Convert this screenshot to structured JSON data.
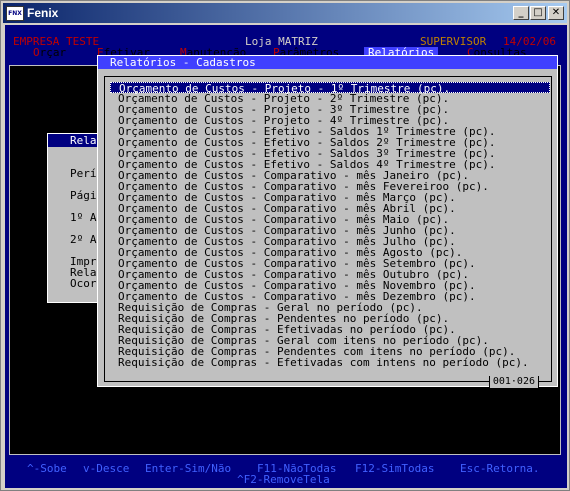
{
  "window": {
    "title": "Fenix",
    "icon_text": "FNX",
    "minimize": "_",
    "maximize": "□",
    "close": "✕"
  },
  "header": {
    "company": "EMPRESA TESTE",
    "store": "Loja MATRIZ",
    "user": "SUPERVISOR",
    "date": "14/02/06",
    "colors": {
      "company": "#c00000",
      "store": "#d4d0c8",
      "user": "#c08000",
      "date": "#c00000"
    }
  },
  "menu": [
    {
      "hot": "O",
      "rest": "rçar"
    },
    {
      "hot": "E",
      "rest": "fetivar"
    },
    {
      "hot": "M",
      "rest": "anutenção"
    },
    {
      "hot": "P",
      "rest": "arâmetros"
    },
    {
      "hot": "",
      "rest": "Relatórios",
      "active": true
    },
    {
      "hot": "C",
      "rest": "onsultas"
    }
  ],
  "left_dialog": {
    "title": "Rela",
    "labels": [
      "Perí",
      "Pági",
      "1º A",
      "2º A",
      "Impr",
      "Rela",
      "Ocor"
    ]
  },
  "popup": {
    "title": "Relatórios - Cadastros",
    "counter": "001·026",
    "items": [
      "Orçamento de Custos - Projeto - 1º Trimestre (pc).",
      "Orçamento de Custos - Projeto - 2º Trimestre (pc).",
      "Orçamento de Custos - Projeto - 3º Trimestre (pc).",
      "Orçamento de Custos - Projeto - 4º Trimestre (pc).",
      "Orçamento de Custos - Efetivo - Saldos 1º Trimestre (pc).",
      "Orçamento de Custos - Efetivo - Saldos 2º Trimestre (pc).",
      "Orçamento de Custos - Efetivo - Saldos 3º Trimestre (pc).",
      "Orçamento de Custos - Efetivo - Saldos 4º Trimestre (pc).",
      "Orçamento de Custos - Comparativo - mês Janeiro (pc).",
      "Orçamento de Custos - Comparativo - mês Fevereiroo (pc).",
      "Orçamento de Custos - Comparativo - mês Março (pc).",
      "Orçamento de Custos - Comparativo - mês Abril (pc).",
      "Orçamento de Custos - Comparativo - mês Maio (pc).",
      "Orçamento de Custos - Comparativo - mês Junho (pc).",
      "Orçamento de Custos - Comparativo - mês Julho (pc).",
      "Orçamento de Custos - Comparativo - mês Agosto (pc).",
      "Orçamento de Custos - Comparativo - mês Setembro (pc).",
      "Orçamento de Custos - Comparativo - mês Outubro (pc).",
      "Orçamento de Custos - Comparativo - mês Novembro (pc).",
      "Orçamento de Custos - Comparativo - mês Dezembro (pc).",
      "Requisição de Compras - Geral no período (pc).",
      "Requisição de Compras - Pendentes no período (pc).",
      "Requisição de Compras - Efetivadas no período (pc).",
      "Requisição de Compras - Geral com itens no período (pc).",
      "Requisição de Compras - Pendentes com itens no período (pc).",
      "Requisição de Compras - Efetivadas com intens no período (pc)."
    ],
    "selected_index": 0
  },
  "status": {
    "hints": [
      "^-Sobe",
      "v-Desce",
      "Enter-Sim/Não",
      "F11-NãoTodas",
      "F12-SimTodas",
      "Esc-Retorna.",
      "^F2-RemoveTela"
    ]
  }
}
